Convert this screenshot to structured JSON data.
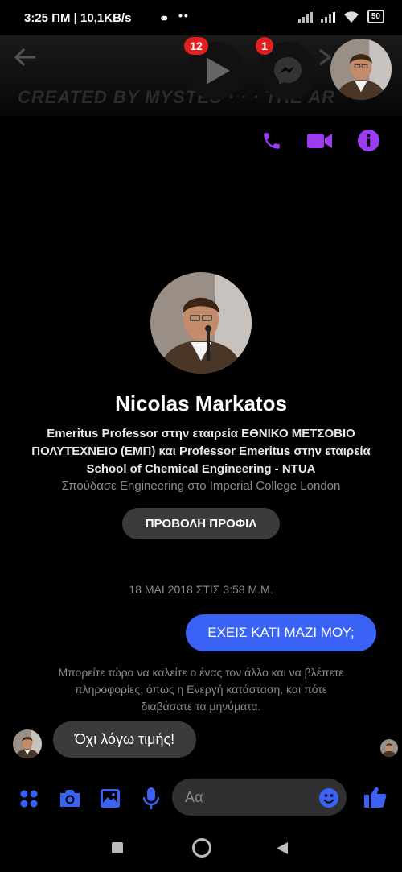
{
  "status_bar": {
    "time_text": "3:25 ΠΜ | 10,1KB/s",
    "battery": "50"
  },
  "header": {
    "watermark": "CREATED BY MYSTES · · · THE AR",
    "video_badge": "12",
    "messenger_badge": "1"
  },
  "profile": {
    "name": "Nicolas Markatos",
    "work": "Emeritus Professor στην εταιρεία ΕΘΝΙΚΟ ΜΕΤΣΟΒΙΟ ΠΟΛΥΤΕΧΝΕΙΟ (ΕΜΠ) και Professor Emeritus στην εταιρεία School of Chemical Engineering - NTUA",
    "education": "Σπούδασε Engineering στο Imperial College London",
    "view_profile_label": "ΠΡΟΒΟΛΗ ΠΡΟΦΙΛ"
  },
  "conversation": {
    "timestamp": "18 ΜΑΙ 2018 ΣΤΙΣ 3:58 Μ.Μ.",
    "sent_message": "ΕΧΕΙΣ ΚΑΤΙ ΜΑΖΙ ΜΟΥ;",
    "info_text": "Μπορείτε τώρα να καλείτε ο ένας τον άλλο και να βλέπετε πληροφορίες, όπως η Ενεργή κατάσταση, και πότε διαβάσατε τα μηνύματα.",
    "received_message": "Όχι λόγω τιμής!"
  },
  "composer": {
    "placeholder": "Αα"
  },
  "colors": {
    "accent": "#9b3cf0",
    "blue": "#3a63f5",
    "bubble_gray": "#3a3b3c"
  }
}
